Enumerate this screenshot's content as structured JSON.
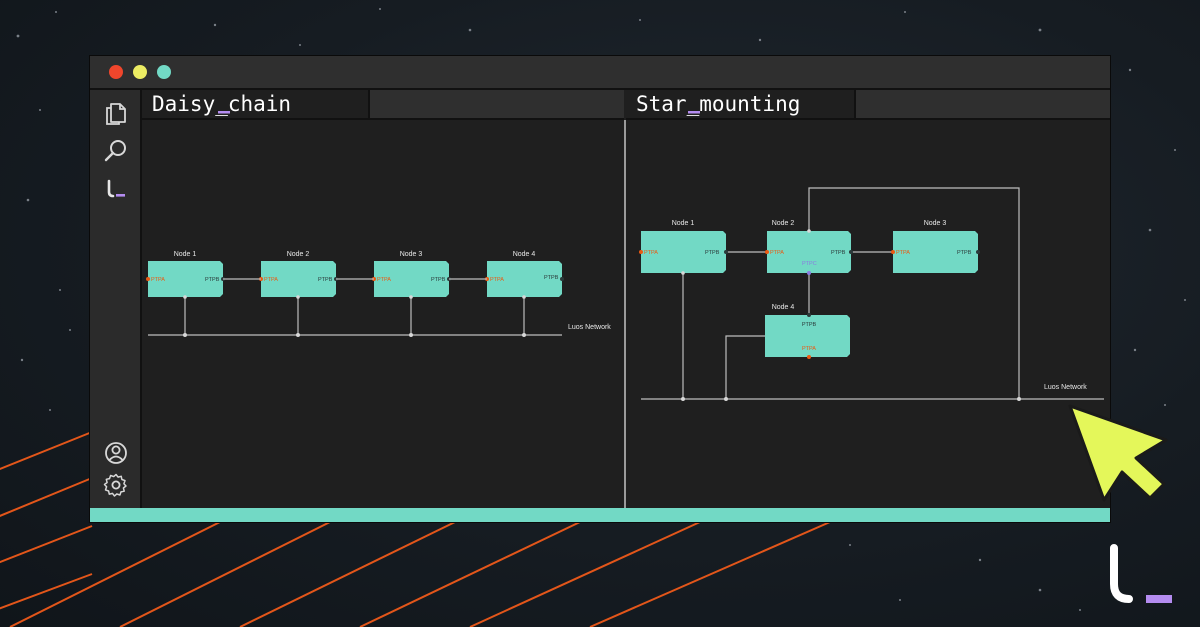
{
  "window": {
    "controls": [
      "close",
      "minimize",
      "maximize"
    ],
    "tabs": [
      {
        "label": "Daisy_chain"
      },
      {
        "label": "Star_mounting"
      }
    ]
  },
  "sidebar": {
    "top_icons": [
      "files-icon",
      "search-icon",
      "luos-logo-icon"
    ],
    "bottom_icons": [
      "account-icon",
      "settings-icon"
    ]
  },
  "daisy_chain": {
    "nodes": [
      {
        "name": "Node 1",
        "port_a": "PTPA",
        "port_b": "PTPB"
      },
      {
        "name": "Node 2",
        "port_a": "PTPA",
        "port_b": "PTPB"
      },
      {
        "name": "Node 3",
        "port_a": "PTPA",
        "port_b": "PTPB"
      },
      {
        "name": "Node 4",
        "port_a": "PTPA",
        "port_b": "PTPB"
      }
    ],
    "network_label": "Luos Network"
  },
  "star_mounting": {
    "nodes": [
      {
        "name": "Node 1",
        "ports": [
          "PTPA",
          "PTPB"
        ]
      },
      {
        "name": "Node 2",
        "ports": [
          "PTPA",
          "PTPB",
          "PTPC"
        ]
      },
      {
        "name": "Node 3",
        "ports": [
          "PTPA",
          "PTPB"
        ]
      },
      {
        "name": "Node 4",
        "ports": [
          "PTPB",
          "PTPA"
        ]
      }
    ],
    "network_label": "Luos Network"
  },
  "colors": {
    "node_fill": "#72d9c5",
    "port_a": "#ea5a13",
    "port_b": "#2b3a3a",
    "port_c": "#8a7ce0",
    "accent_bar": "#72d9c5",
    "cursor": "#e4f75a",
    "brand_underscore": "#b48cf0",
    "background_stripes": "#e3561a"
  }
}
